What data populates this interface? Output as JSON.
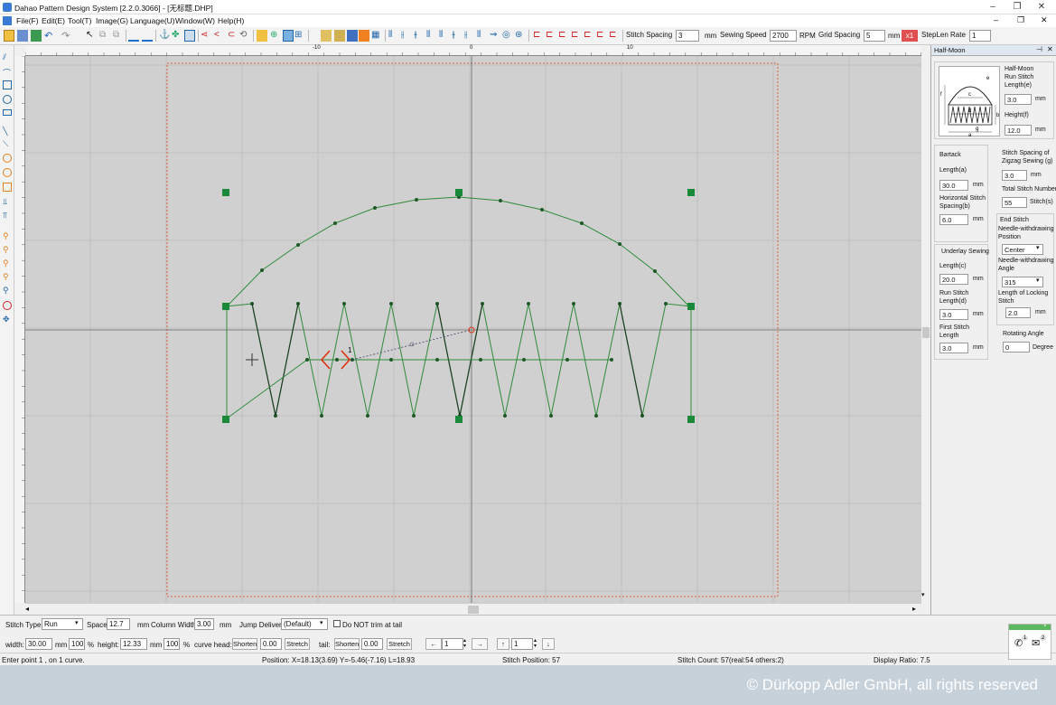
{
  "window": {
    "title": "Dahao Pattern Design System [2.2.0.3066] - [无标题.DHP]"
  },
  "menus": [
    "File(F)",
    "Edit(E)",
    "Tool(T)",
    "Image(G)",
    "Language(U)",
    "Window(W)",
    "Help(H)"
  ],
  "toolbar": {
    "stitch_spacing_label": "Stitch Spacing",
    "stitch_spacing_value": "3",
    "stitch_spacing_unit": "mm",
    "sewing_speed_label": "Sewing Speed",
    "sewing_speed_value": "2700",
    "sewing_speed_unit": "RPM",
    "grid_spacing_label": "Grid Spacing",
    "grid_spacing_value": "5",
    "grid_spacing_unit": "mm",
    "zoom_badge": "x1",
    "steplen_label": "StepLen Rate",
    "steplen_value": "1"
  },
  "ruler": {
    "marks": [
      "-10",
      "0",
      "10"
    ]
  },
  "panel": {
    "title": "Half-Moon",
    "diagram_labels": [
      "a",
      "b",
      "c",
      "d",
      "e",
      "f",
      "g"
    ],
    "half_moon_heading": "Half-Moon",
    "run_stitch_len_label": "Run Stitch Length(e)",
    "run_stitch_len": "3.0",
    "height_label": "Height(f)",
    "height": "12.0",
    "bartack_label": "Bartack",
    "length_a_label": "Length(a)",
    "length_a": "30.0",
    "hspacing_label": "Horizontal Stitch Spacing(b)",
    "hspacing": "6.0",
    "zigzag_label": "Stitch Spacing of Zigzag Sewing (g)",
    "zigzag": "3.0",
    "total_label": "Total Stitch Number",
    "total": "55",
    "total_unit": "Stitch(s)",
    "end_stitch_label": "End Stitch",
    "nw_pos_label": "Needle-withdrawing Position",
    "nw_pos": "Center",
    "nw_angle_label": "Needle-withdrawing Angle",
    "nw_angle": "315",
    "underlay_label": "Underlay Sewing",
    "length_c_label": "Length(c)",
    "length_c": "20.0",
    "run_d_label": "Run Stitch Length(d)",
    "run_d": "3.0",
    "locking_label": "Length of Locking Stitch",
    "locking": "2.0",
    "first_label": "First Stitch Length",
    "first": "3.0",
    "rotate_label": "Rotating Angle",
    "rotate": "0",
    "rotate_unit": "Degree",
    "mm": "mm"
  },
  "bottom": {
    "stitch_type_label": "Stitch Type:",
    "stitch_type": "Run",
    "space_label": "Space:",
    "space": "12.7",
    "mm": "mm",
    "col_width_label": "Column Width:",
    "col_width": "3.00",
    "jump_label": "Jump Delivery:",
    "jump": "(Default)",
    "no_trim": "Do NOT trim at tail",
    "width_label": "width:",
    "width": "30.00",
    "width_pct": "100",
    "pct": "%",
    "height_label": "height:",
    "height": "12.33",
    "height_pct": "100",
    "curve_head_label": "curve head:",
    "shorten": "Shorten",
    "head_val": "0.00",
    "stretch": "Stretch",
    "tail_label": "tail:",
    "tail_val": "0.00",
    "nav_left": "←",
    "nav_val": "1",
    "nav_right": "→",
    "nav_up": "↑",
    "nav_val2": "1",
    "nav_down": "↓"
  },
  "status": {
    "message": "Enter point 1 , on 1 curve.",
    "position": "Position: X=18.13(3.69) Y=-5.46(-7.16) L=18.93",
    "stitch_position": "Stitch Position: 57",
    "stitch_count": "Stitch Count: 57(real:54 others:2)",
    "display_ratio": "Display Ratio: 7.5"
  },
  "notification": {
    "badge1": "1",
    "badge2": "2"
  },
  "copyright": "© Dürkopp Adler GmbH, all rights reserved",
  "canvas": {
    "point_label": "1"
  },
  "colors": {
    "canvas": "#d0d0d0",
    "stitch": "#2e8b3a",
    "handle": "#1a8a3a",
    "cursor": "#e03010",
    "page_border": "#e06040"
  }
}
